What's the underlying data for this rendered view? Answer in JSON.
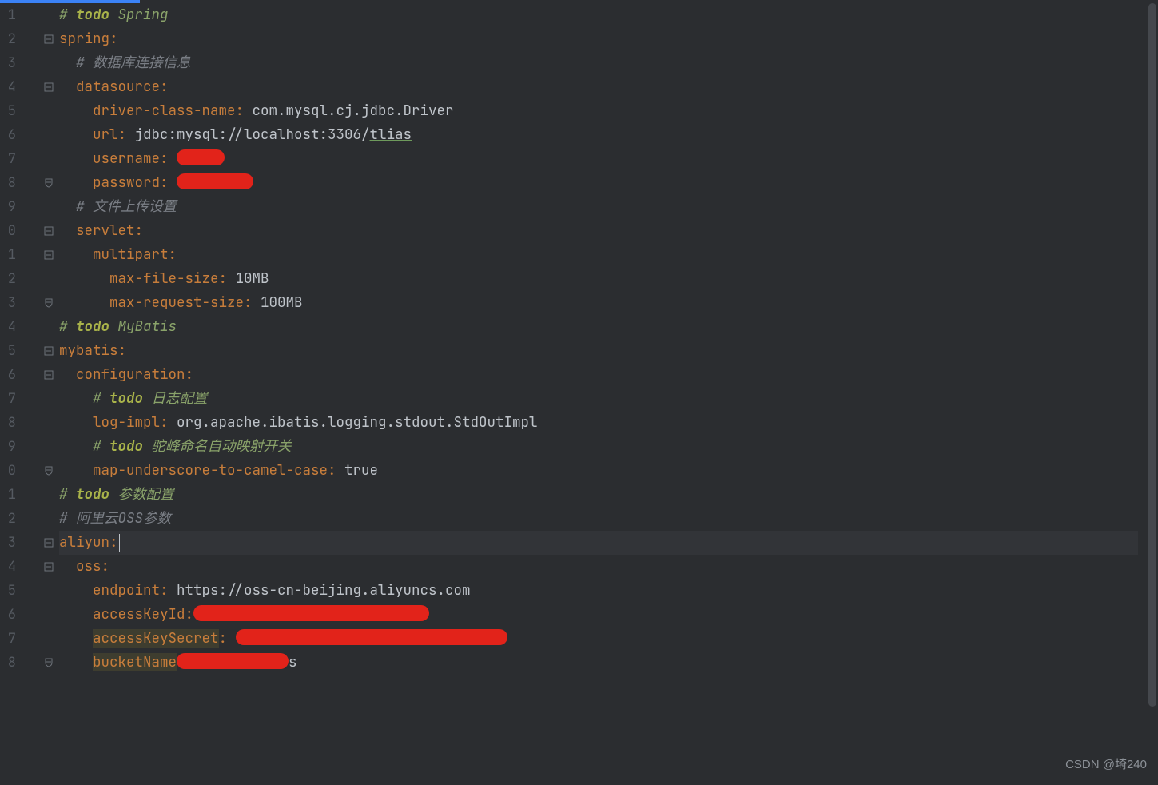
{
  "watermark": "CSDN @埼240",
  "gutter": {
    "start": 1,
    "end": 28,
    "visibleDigits": 1
  },
  "fold": {
    "1": "",
    "2": "open",
    "3": "",
    "4": "open",
    "5": "",
    "6": "",
    "7": "",
    "8": "close",
    "9": "",
    "10": "open",
    "11": "open",
    "12": "",
    "13": "close3",
    "14": "",
    "15": "open",
    "16": "open",
    "17": "",
    "18": "",
    "19": "",
    "20": "close2",
    "21": "",
    "22": "",
    "23": "open",
    "24": "open",
    "25": "",
    "26": "",
    "27": "",
    "28": "close2"
  },
  "lines": {
    "1": {
      "type": "comment_todo",
      "hash": "# ",
      "todo": "todo ",
      "rest": "Spring"
    },
    "2": {
      "type": "key",
      "indent": "",
      "k": "spring",
      "after": ":"
    },
    "3": {
      "type": "comment",
      "indent": "  ",
      "hash": "# ",
      "rest": "数据库连接信息"
    },
    "4": {
      "type": "key",
      "indent": "  ",
      "k": "datasource",
      "after": ":"
    },
    "5": {
      "type": "kv",
      "indent": "    ",
      "k": "driver-class-name",
      "v": "com.mysql.cj.jdbc.Driver"
    },
    "6": {
      "type": "kv_url",
      "indent": "    ",
      "k": "url",
      "v1": "jdbc:mysql://localhost:3306/",
      "v2": "tlias"
    },
    "7": {
      "type": "kv_red",
      "indent": "    ",
      "k": "username",
      "redw": 60
    },
    "8": {
      "type": "kv_red",
      "indent": "    ",
      "k": "password",
      "redw": 96
    },
    "9": {
      "type": "comment",
      "indent": "  ",
      "hash": "# ",
      "rest": "文件上传设置"
    },
    "10": {
      "type": "key",
      "indent": "  ",
      "k": "servlet",
      "after": ":"
    },
    "11": {
      "type": "key",
      "indent": "    ",
      "k": "multipart",
      "after": ":"
    },
    "12": {
      "type": "kv",
      "indent": "      ",
      "k": "max-file-size",
      "v": "10MB"
    },
    "13": {
      "type": "kv",
      "indent": "      ",
      "k": "max-request-size",
      "v": "100MB"
    },
    "14": {
      "type": "comment_todo",
      "hash": "# ",
      "todo": "todo ",
      "rest": "MyBatis"
    },
    "15": {
      "type": "key",
      "indent": "",
      "k": "mybatis",
      "after": ":"
    },
    "16": {
      "type": "key",
      "indent": "  ",
      "k": "configuration",
      "after": ":"
    },
    "17": {
      "type": "comment_todo",
      "indent": "    ",
      "hash": "# ",
      "todo": "todo ",
      "rest": "日志配置"
    },
    "18": {
      "type": "kv",
      "indent": "    ",
      "k": "log-impl",
      "v": "org.apache.ibatis.logging.stdout.StdOutImpl"
    },
    "19": {
      "type": "comment_todo",
      "indent": "    ",
      "hash": "# ",
      "todo": "todo ",
      "rest": "驼峰命名自动映射开关"
    },
    "20": {
      "type": "kv",
      "indent": "    ",
      "k": "map-underscore-to-camel-case",
      "v": "true"
    },
    "21": {
      "type": "comment_todo",
      "indent": "",
      "hash": "# ",
      "todo": "todo ",
      "rest": "参数配置"
    },
    "22": {
      "type": "comment",
      "indent": "",
      "hash": "# ",
      "rest": "阿里云OSS参数"
    },
    "23": {
      "type": "key_warn",
      "indent": "",
      "k": "aliyun",
      "after": ":",
      "caret": true,
      "hl": true
    },
    "24": {
      "type": "key",
      "indent": "  ",
      "k": "oss",
      "after": ":"
    },
    "25": {
      "type": "kv_link",
      "indent": "    ",
      "k": "endpoint",
      "v": "https://oss-cn-beijing.aliyuncs.com"
    },
    "26": {
      "type": "kv_red",
      "indent": "    ",
      "k": "accessKeyId",
      "redw": 295,
      "tight": true
    },
    "27": {
      "type": "kv_red_warn",
      "indent": "    ",
      "k": "accessKeySecret",
      "redw": 340
    },
    "28": {
      "type": "kv_red_warn2",
      "indent": "    ",
      "k": "bucketName",
      "redw": 140,
      "tail": "s"
    }
  }
}
